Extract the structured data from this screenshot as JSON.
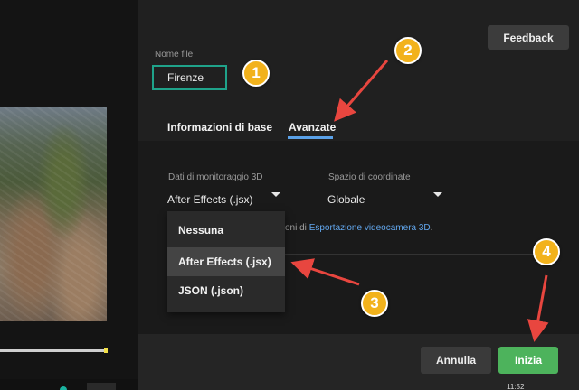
{
  "header": {
    "feedback_label": "Feedback"
  },
  "filename": {
    "label": "Nome file",
    "value": "Firenze"
  },
  "tabs": [
    {
      "label": "Informazioni di base",
      "active": false
    },
    {
      "label": "Avanzate",
      "active": true
    }
  ],
  "tracking": {
    "label": "Dati di monitoraggio 3D",
    "selected": "After Effects (.jsx)",
    "options": [
      "Nessuna",
      "After Effects (.jsx)",
      "JSON (.json)"
    ]
  },
  "coordinates": {
    "label": "Spazio di coordinate",
    "selected": "Globale"
  },
  "info": {
    "prefix": "oni di ",
    "link": "Esportazione videocamera 3D",
    "suffix": "."
  },
  "footer": {
    "cancel_label": "Annulla",
    "start_label": "Inizia"
  },
  "status": {
    "time": "11:52"
  },
  "annotations": [
    "1",
    "2",
    "3",
    "4"
  ],
  "colors": {
    "accent_blue": "#5aa1e8",
    "start_green": "#4db35c",
    "badge_orange": "#f2b21c",
    "arrow_red": "#e8463f",
    "input_border": "#1fa38a"
  }
}
